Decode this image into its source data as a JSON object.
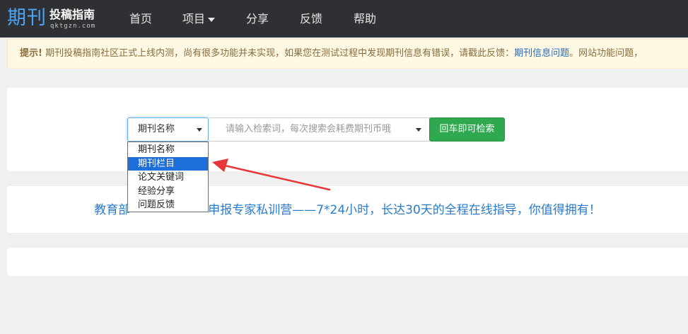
{
  "navbar": {
    "logo_main": "期刊",
    "logo_sub": "投稿指南",
    "logo_domain": "qktgzn.com",
    "items": [
      {
        "label": "首页"
      },
      {
        "label": "项目"
      },
      {
        "label": "分享"
      },
      {
        "label": "反馈"
      },
      {
        "label": "帮助"
      }
    ]
  },
  "notice": {
    "prefix": "提示!",
    "text": " 期刊投稿指南社区正式上线内测，尚有很多功能并未实现，如果您在测试过程中发现期刊信息有错误，请戳此反馈：",
    "link": "期刊信息问题",
    "suffix": "。网站功能问题，"
  },
  "search": {
    "select_value": "期刊名称",
    "placeholder": "请输入检索词，每次搜索会耗费期刊币哦",
    "button_label": "回车即可检索",
    "options": [
      "期刊名称",
      "期刊栏目",
      "论文关键词",
      "经验分享",
      "问题反馈"
    ],
    "highlighted_option": "期刊栏目"
  },
  "promo": {
    "left": "教育部",
    "right": "申报专家私训营——7*24小时，长达30天的全程在线指导，你值得拥有！"
  },
  "colors": {
    "navbar_bg": "#2f3033",
    "logo_blue": "#4aa5f5",
    "notice_bg": "#fcf8e3",
    "link": "#2a6bbf",
    "button_green": "#2fa84f",
    "promo_blue": "#2a7ac9",
    "highlight": "#1e6fd9",
    "annotation_arrow": "#e8373a"
  },
  "icons": {
    "nav_dropdown": "caret-down-icon",
    "select_dropdown": "caret-down-icon",
    "annotation": "red-arrow-icon"
  }
}
